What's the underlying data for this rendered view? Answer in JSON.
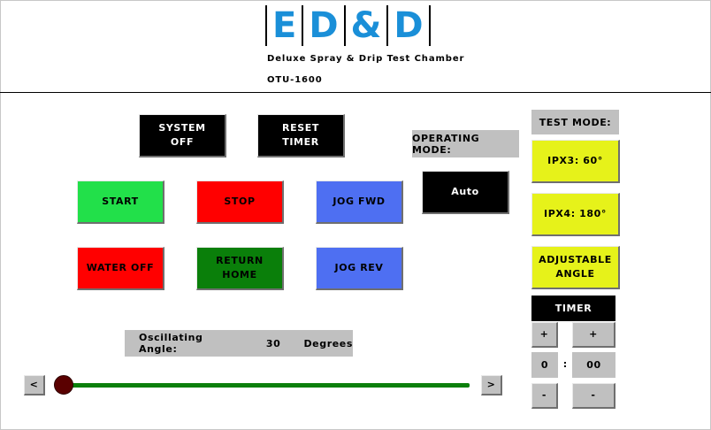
{
  "header": {
    "logo_letters": [
      "E",
      "D",
      "&",
      "D"
    ],
    "title": "Deluxe Spray & Drip Test Chamber",
    "model": "OTU-1600"
  },
  "controls": {
    "system_off": "SYSTEM\nOFF",
    "reset_timer": "RESET\nTIMER",
    "start": "START",
    "stop": "STOP",
    "jog_fwd": "JOG FWD",
    "water_off": "WATER OFF",
    "return_home": "RETURN\nHOME",
    "jog_rev": "JOG REV"
  },
  "operating_mode": {
    "label": "OPERATING MODE:",
    "value": "Auto"
  },
  "test_mode": {
    "label": "TEST MODE:",
    "options": [
      "IPX3: 60°",
      "IPX4: 180°",
      "ADJUSTABLE\nANGLE"
    ]
  },
  "timer": {
    "label": "TIMER",
    "plus": "+",
    "minus": "-",
    "minutes": "0",
    "separator": ":",
    "seconds": "00"
  },
  "angle": {
    "label": "Oscillating Angle:",
    "value": "30",
    "unit": "Degrees",
    "decrease": "<",
    "increase": ">",
    "slider_fraction": 0.0
  },
  "colors": {
    "start": "#22e04a",
    "stop": "#ff0000",
    "jog": "#4e6ff2",
    "return_home": "#0a7f0a",
    "test_mode_option": "#e6f21a",
    "logo_blue": "#1a8fd8"
  }
}
